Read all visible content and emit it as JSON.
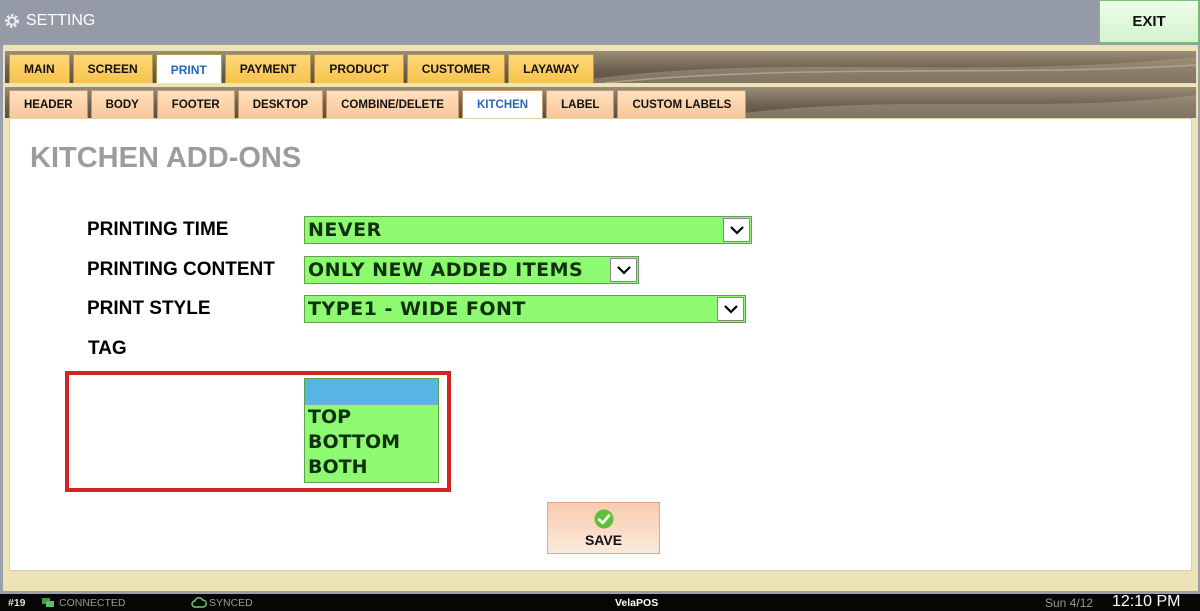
{
  "window": {
    "title": "SETTING",
    "exit_label": "EXIT"
  },
  "main_tabs": [
    "MAIN",
    "SCREEN",
    "PRINT",
    "PAYMENT",
    "PRODUCT",
    "CUSTOMER",
    "LAYAWAY"
  ],
  "main_tab_active": "PRINT",
  "sub_tabs": [
    "HEADER",
    "BODY",
    "FOOTER",
    "DESKTOP",
    "COMBINE/DELETE",
    "KITCHEN",
    "LABEL",
    "CUSTOM LABELS"
  ],
  "sub_tab_active": "KITCHEN",
  "section": {
    "heading": "KITCHEN ADD-ONS"
  },
  "form": {
    "printing_time": {
      "label": "PRINTING TIME",
      "value": "NEVER"
    },
    "printing_content": {
      "label": "PRINTING CONTENT",
      "value": "ONLY NEW ADDED ITEMS"
    },
    "print_style": {
      "label": "PRINT STYLE",
      "value": "TYPE1 - WIDE FONT"
    },
    "tag": {
      "label": "TAG",
      "options": [
        "",
        "TOP",
        "BOTTOM",
        "BOTH"
      ],
      "selected_index": 0
    }
  },
  "save_label": "SAVE",
  "status": {
    "terminal": "#19",
    "connection": "CONNECTED",
    "sync": "SYNCED",
    "brand": "VelaPOS",
    "date": "Sun 4/12",
    "time": "12:10 PM"
  },
  "colors": {
    "field_green": "#8dfa72",
    "highlight_red": "#d32323",
    "active_tab_text": "#2567b6",
    "selected_option": "#57b5e6"
  }
}
